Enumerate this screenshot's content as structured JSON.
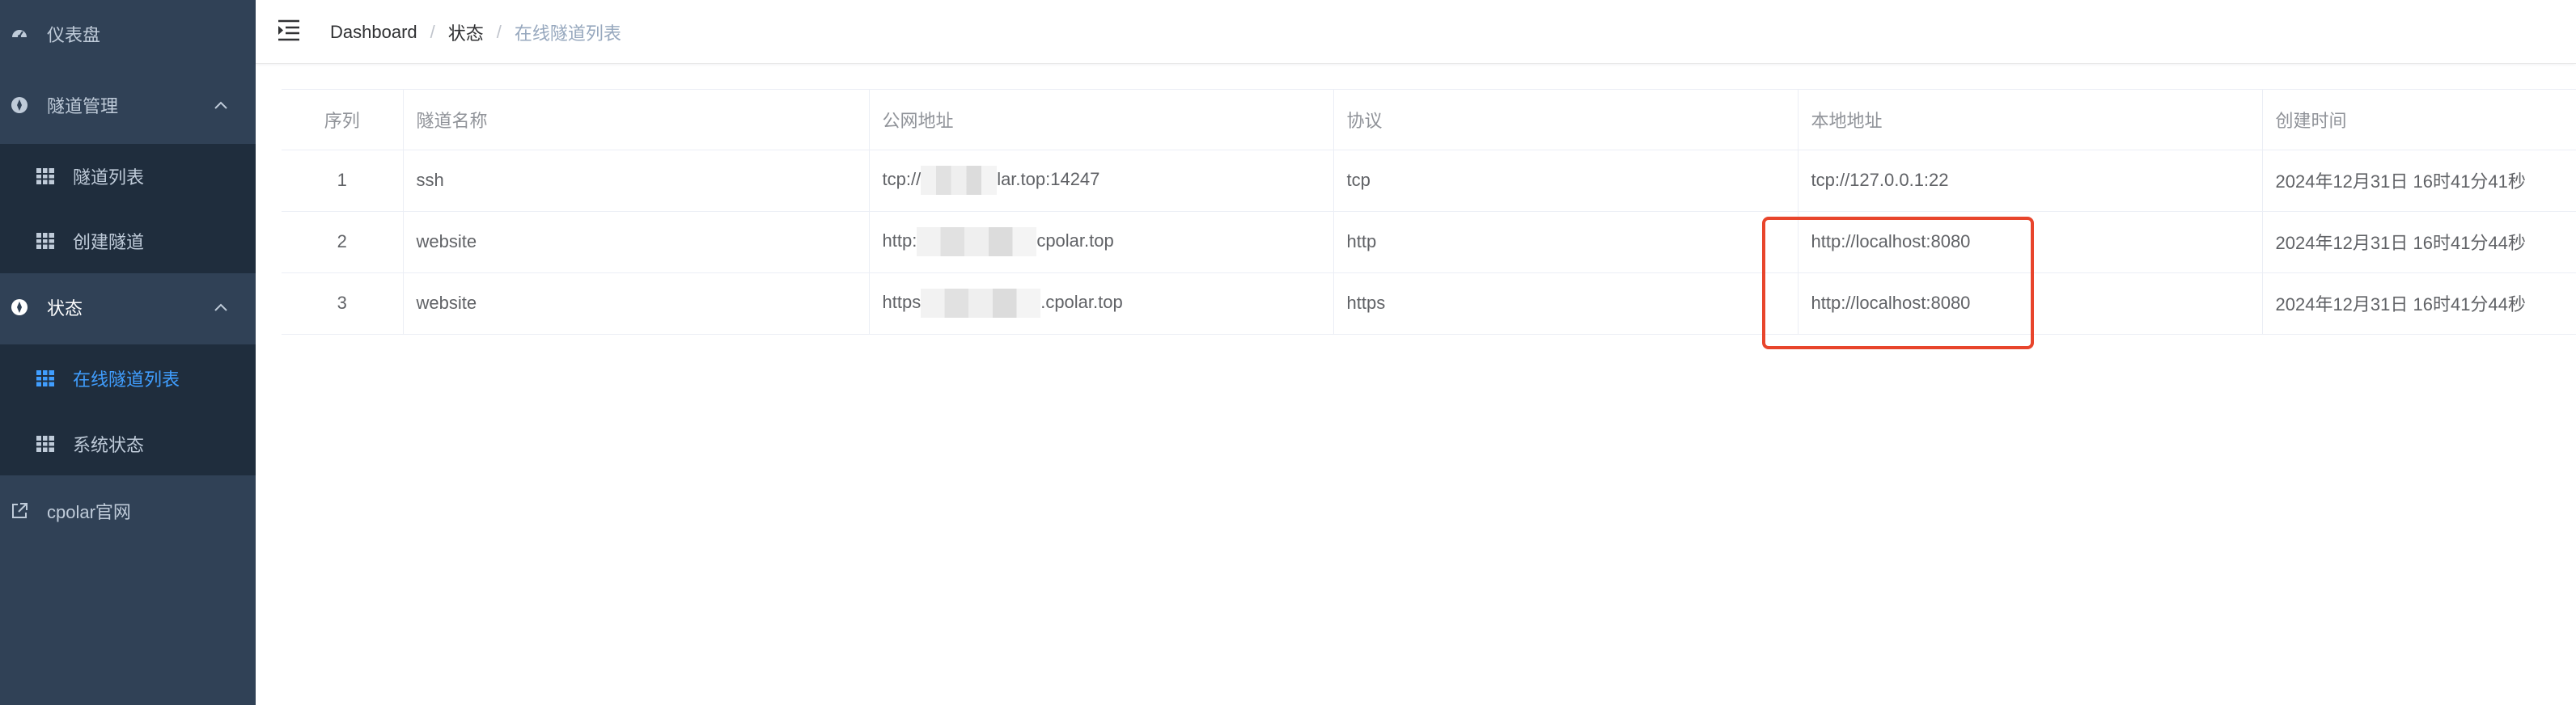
{
  "sidebar": {
    "items": [
      {
        "label": "仪表盘",
        "icon": "dashboard-icon"
      },
      {
        "label": "隧道管理",
        "icon": "compass-icon",
        "expanded": true,
        "children": [
          {
            "label": "隧道列表",
            "icon": "grid-icon"
          },
          {
            "label": "创建隧道",
            "icon": "grid-icon"
          }
        ]
      },
      {
        "label": "状态",
        "icon": "compass-icon",
        "expanded": true,
        "children": [
          {
            "label": "在线隧道列表",
            "icon": "grid-icon",
            "active": true
          },
          {
            "label": "系统状态",
            "icon": "grid-icon"
          }
        ]
      },
      {
        "label": "cpolar官网",
        "icon": "external-link-icon"
      }
    ]
  },
  "breadcrumb": {
    "items": [
      "Dashboard",
      "状态",
      "在线隧道列表"
    ],
    "separator": "/"
  },
  "table": {
    "columns": [
      "序列",
      "隧道名称",
      "公网地址",
      "协议",
      "本地地址",
      "创建时间"
    ],
    "rows": [
      {
        "index": "1",
        "name": "ssh",
        "public_prefix": "tcp://",
        "public_suffix": "lar.top:14247",
        "protocol": "tcp",
        "local": "tcp://127.0.0.1:22",
        "created": "2024年12月31日 16时41分41秒"
      },
      {
        "index": "2",
        "name": "website",
        "public_prefix": "http:",
        "public_suffix": "cpolar.top",
        "protocol": "http",
        "local": "http://localhost:8080",
        "created": "2024年12月31日 16时41分44秒"
      },
      {
        "index": "3",
        "name": "website",
        "public_prefix": "https",
        "public_suffix": ".cpolar.top",
        "protocol": "https",
        "local": "http://localhost:8080",
        "created": "2024年12月31日 16时41分44秒"
      }
    ]
  },
  "colors": {
    "sidebar_bg": "#304156",
    "submenu_bg": "#1f2d3d",
    "active": "#409eff",
    "highlight": "#e8452c"
  }
}
